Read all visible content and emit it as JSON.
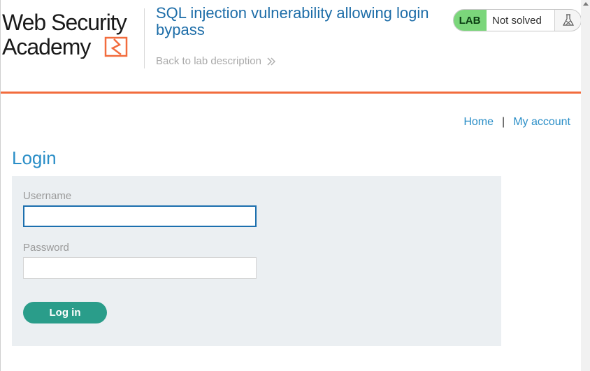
{
  "header": {
    "logo_text_line1": "Web Security",
    "logo_text_line2": "Academy",
    "lab_title": "SQL injection vulnerability allowing login bypass",
    "back_link": "Back to lab description",
    "lab_badge": "LAB",
    "lab_status": "Not solved"
  },
  "nav": {
    "home": "Home",
    "separator": "|",
    "my_account": "My account"
  },
  "main": {
    "heading": "Login",
    "username_label": "Username",
    "username_value": "",
    "password_label": "Password",
    "password_value": "",
    "login_button": "Log in"
  },
  "colors": {
    "accent_orange": "#f26c3d",
    "link_blue": "#2a8ec7",
    "lab_green": "#7bd67b",
    "button_teal": "#2a9d8a",
    "panel_bg": "#ebeff2"
  }
}
